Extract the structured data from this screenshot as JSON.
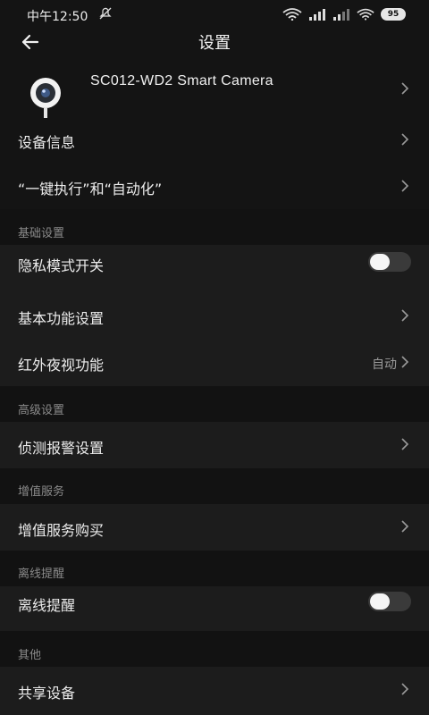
{
  "status_bar": {
    "time": "中午12:50",
    "battery": "95"
  },
  "header": {
    "title": "设置"
  },
  "device": {
    "name": "SC012-WD2 Smart Camera"
  },
  "top_rows": [
    {
      "label": "设备信息"
    },
    {
      "label": "“一键执行”和“自动化”"
    }
  ],
  "sections": {
    "basic": {
      "title": "基础设置",
      "privacy_mode": "隐私模式开关",
      "privacy_mode_on": false,
      "basic_features": "基本功能设置",
      "night_vision": "红外夜视功能",
      "night_vision_value": "自动"
    },
    "advanced": {
      "title": "高级设置",
      "detection_alarm": "侦测报警设置"
    },
    "value_added": {
      "title": "增值服务",
      "purchase": "增值服务购买"
    },
    "offline": {
      "title": "离线提醒",
      "offline_alert": "离线提醒",
      "offline_alert_on": false
    },
    "other": {
      "title": "其他",
      "share_device": "共享设备"
    }
  },
  "colors": {
    "background": "#141414",
    "row_background": "#1c1c1c",
    "section_text": "#8a8a8a",
    "toggle_off": "#3a3a3a"
  },
  "icons": [
    "back-arrow-icon",
    "camera-icon",
    "chevron-right-icon",
    "mute-icon",
    "wifi-icon",
    "signal-icon",
    "battery-icon"
  ]
}
